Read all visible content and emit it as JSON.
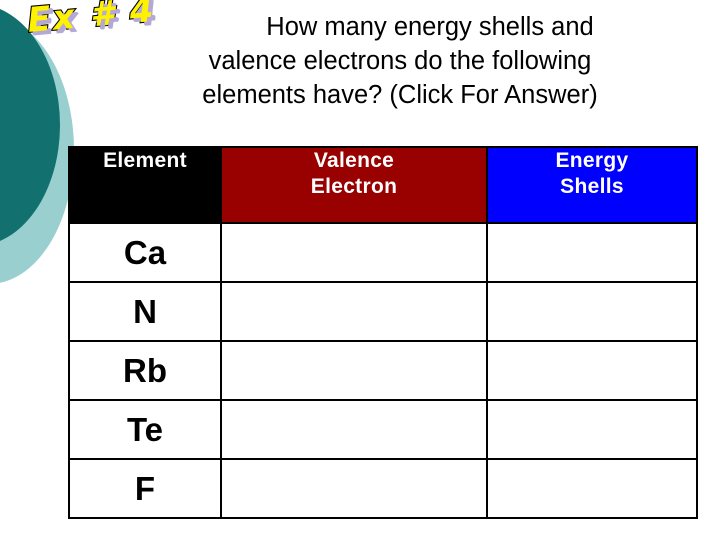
{
  "slide": {
    "background_color": "#FFFFFF"
  },
  "decoration": {
    "circle_dark_color": "#12716E",
    "circle_light_color": "#9ACFD0",
    "circle_dark_name": "dark-teal-circle",
    "circle_light_name": "light-teal-circle"
  },
  "wordart": {
    "text": "Ex # 4",
    "fill_color": "#FFF200",
    "outline_color": "#000000",
    "shadow_color": "#B3A8D8"
  },
  "title": {
    "line1": "How many energy shells and",
    "line2": "valence electrons do the following",
    "line3": "elements have? (Click For Answer)",
    "full_text": "How many energy shells and valence electrons do the following elements have? (Click For Answer)",
    "color": "#000000"
  },
  "table": {
    "headers": [
      {
        "label": "Element",
        "background": "#000000",
        "text_color": "#FFFFFF"
      },
      {
        "label": "Valence Electron",
        "background": "#990000",
        "text_color": "#FFFFFF"
      },
      {
        "label": "Energy Shells",
        "background": "#0000FF",
        "text_color": "#FFFFFF"
      }
    ],
    "header_line_breaks": {
      "valence_line1": "Valence",
      "valence_line2": "Electron",
      "shells_line1": "Energy",
      "shells_line2": "Shells"
    },
    "rows": [
      {
        "element": "Ca",
        "valence_electron": "",
        "energy_shells": ""
      },
      {
        "element": "N",
        "valence_electron": "",
        "energy_shells": ""
      },
      {
        "element": "Rb",
        "valence_electron": "",
        "energy_shells": ""
      },
      {
        "element": "Te",
        "valence_electron": "",
        "energy_shells": ""
      },
      {
        "element": "F",
        "valence_electron": "",
        "energy_shells": ""
      }
    ],
    "border_color": "#000000",
    "cell_background": "#FFFFFF"
  }
}
